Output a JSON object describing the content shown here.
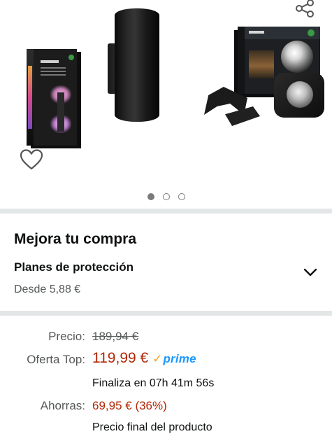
{
  "gallery": {
    "dots_total": 3,
    "active_dot": 0
  },
  "upsell": {
    "title": "Mejora tu compra",
    "plan_title": "Planes de protección",
    "plan_price": "Desde 5,88 €"
  },
  "price": {
    "list_label": "Precio:",
    "list_price": "189,94 €",
    "deal_label": "Oferta Top:",
    "deal_price": "119,99 €",
    "prime_check": "✓",
    "prime_word": "prime",
    "countdown": "Finaliza en 07h 41m 56s",
    "savings_label": "Ahorras:",
    "savings_value": "69,95 € (36%)",
    "final_note": "Precio final del producto"
  },
  "colors": {
    "deal_red": "#b12704",
    "prime_blue": "#1a98ff",
    "prime_check": "#f8a51b",
    "separator": "#e3e6e6"
  },
  "icons": [
    "share-icon",
    "heart-icon",
    "chevron-down-icon"
  ]
}
